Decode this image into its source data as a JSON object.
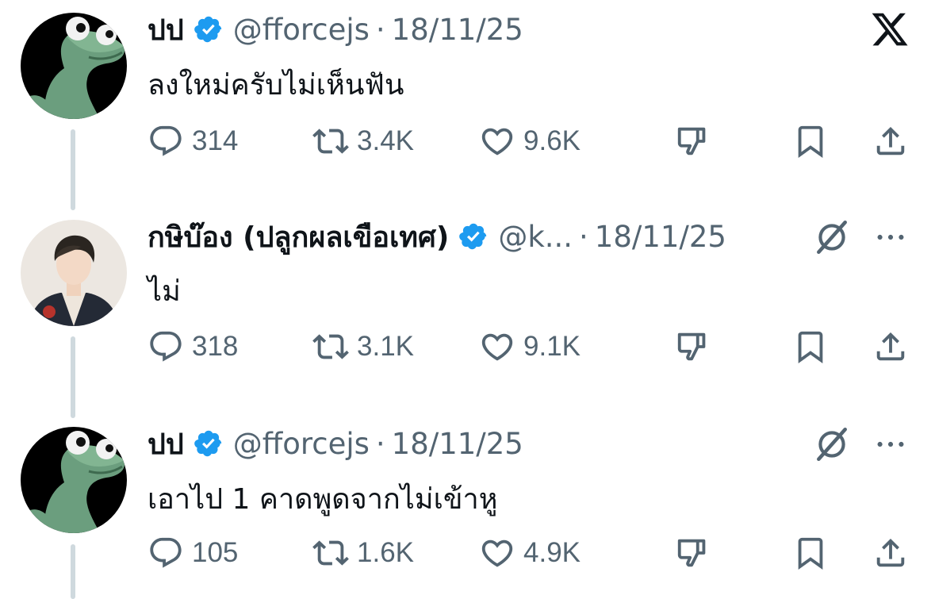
{
  "tweets": [
    {
      "name": "ปป",
      "handle": "@fforcejs",
      "separator": "·",
      "date": "18/11/25",
      "text": "ลงใหม่ครับไม่เห็นฟัน",
      "replies": "314",
      "retweets": "3.4K",
      "likes": "9.6K",
      "avatar": "frog-avatar",
      "top_right_icon": "x-logo"
    },
    {
      "name": "กษิบ๊อง (ปลูกผลเขือเทศ)",
      "handle": "@k...",
      "separator": "·",
      "date": "18/11/25",
      "text": "ไม่",
      "replies": "318",
      "retweets": "3.1K",
      "likes": "9.1K",
      "avatar": "person-avatar",
      "top_right_icon": "grok-icon"
    },
    {
      "name": "ปป",
      "handle": "@fforcejs",
      "separator": "·",
      "date": "18/11/25",
      "text": "เอาไป 1 คาดพูดจากไม่เข้าหู",
      "replies": "105",
      "retweets": "1.6K",
      "likes": "4.9K",
      "avatar": "frog-avatar",
      "top_right_icon": "grok-icon"
    }
  ],
  "colors": {
    "text": "#0f1419",
    "secondary": "#536471",
    "verified": "#1d9bf0",
    "thread_line": "#cfd9de"
  }
}
